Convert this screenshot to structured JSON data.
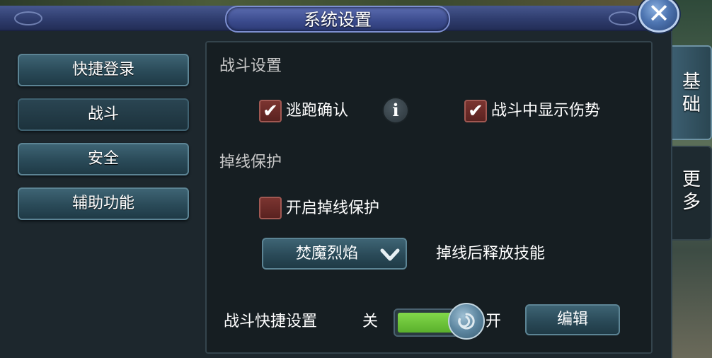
{
  "window": {
    "title": "系统设置",
    "close_symbol": "✕"
  },
  "nav": {
    "items": [
      {
        "label": "快捷登录",
        "active": false
      },
      {
        "label": "战斗",
        "active": true
      },
      {
        "label": "安全",
        "active": false
      },
      {
        "label": "辅助功能",
        "active": false
      }
    ]
  },
  "side_tabs": [
    {
      "label": "基础",
      "active": true
    },
    {
      "label": "更多",
      "active": false
    }
  ],
  "battle": {
    "section_title": "战斗设置",
    "options": [
      {
        "label": "逃跑确认",
        "checked": true,
        "check_mark": "✔"
      },
      {
        "label": "战斗中显示伤势",
        "checked": true,
        "check_mark": "✔"
      }
    ],
    "info_icon": "info-icon",
    "info_symbol": "i"
  },
  "disconnect": {
    "section_title": "掉线保护",
    "enable_label": "开启掉线保护",
    "enabled": false,
    "skill_selected": "焚魔烈焰",
    "skill_description": "掉线后释放技能"
  },
  "quick_battle": {
    "label": "战斗快捷设置",
    "off_label": "关",
    "on_label": "开",
    "toggle_on": true,
    "edit_label": "编辑"
  }
}
